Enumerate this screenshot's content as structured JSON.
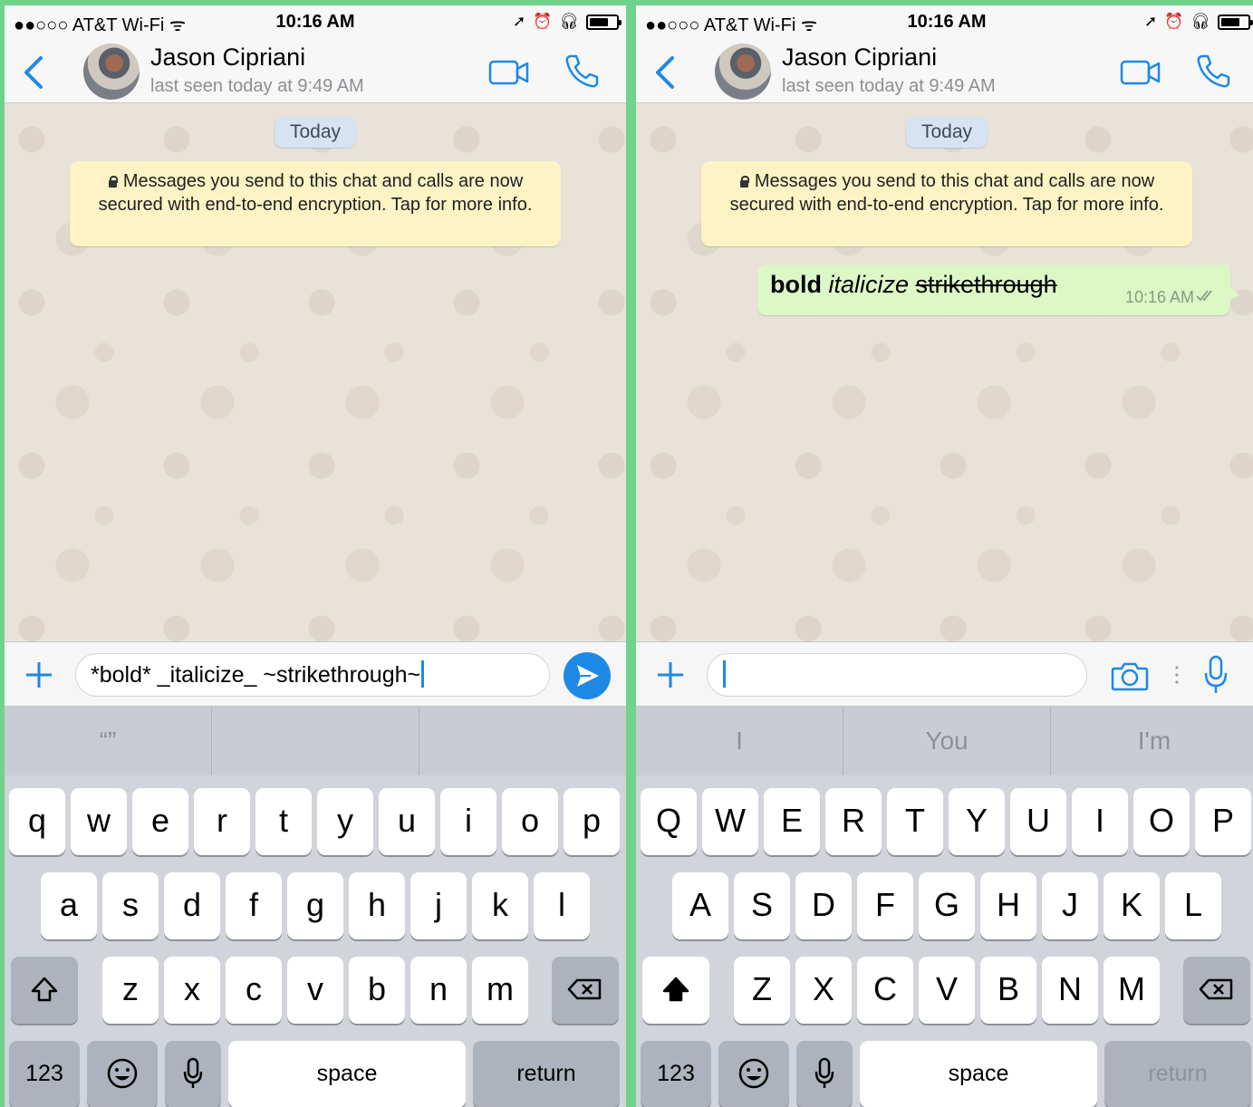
{
  "screens": {
    "left": {
      "status_bar": {
        "carrier": "●●○○○ AT&T Wi-Fi ᯤ",
        "time": "10:16 AM"
      },
      "header": {
        "contact_name": "Jason Cipriani",
        "last_seen": "last seen today at 9:49 AM"
      },
      "chat": {
        "date_label": "Today",
        "encryption_note": "Messages you send to this chat and calls are now secured with end-to-end encryption. Tap for more info."
      },
      "input": {
        "text": "*bold* _italicize_ ~strikethrough~"
      },
      "predictions": [
        "“”",
        "",
        ""
      ],
      "keyboard": {
        "row1": [
          "q",
          "w",
          "e",
          "r",
          "t",
          "y",
          "u",
          "i",
          "o",
          "p"
        ],
        "row2": [
          "a",
          "s",
          "d",
          "f",
          "g",
          "h",
          "j",
          "k",
          "l"
        ],
        "row3": [
          "z",
          "x",
          "c",
          "v",
          "b",
          "n",
          "m"
        ],
        "numbers_label": "123",
        "space_label": "space",
        "return_label": "return"
      }
    },
    "right": {
      "status_bar": {
        "carrier": "●●○○○ AT&T Wi-Fi ᯤ",
        "time": "10:16 AM"
      },
      "header": {
        "contact_name": "Jason Cipriani",
        "last_seen": "last seen today at 9:49 AM"
      },
      "chat": {
        "date_label": "Today",
        "encryption_note": "Messages you send to this chat and calls are now secured with end-to-end encryption. Tap for more info.",
        "message": {
          "bold": "bold",
          "italic": "italicize",
          "strike": "strikethrough",
          "time": "10:16 AM"
        }
      },
      "input": {
        "text": ""
      },
      "predictions": [
        "I",
        "You",
        "I'm"
      ],
      "keyboard": {
        "row1": [
          "Q",
          "W",
          "E",
          "R",
          "T",
          "Y",
          "U",
          "I",
          "O",
          "P"
        ],
        "row2": [
          "A",
          "S",
          "D",
          "F",
          "G",
          "H",
          "J",
          "K",
          "L"
        ],
        "row3": [
          "Z",
          "X",
          "C",
          "V",
          "B",
          "N",
          "M"
        ],
        "numbers_label": "123",
        "space_label": "space",
        "return_label": "return"
      }
    }
  },
  "colors": {
    "accent": "#1e88e5",
    "frame_background": "#6fd38a",
    "bubble_outgoing": "#dcf8c6",
    "encryption_note": "#fdf3c4",
    "date_chip": "#d5e3f3"
  },
  "icons": [
    "back-chevron-icon",
    "video-call-icon",
    "phone-icon",
    "lock-icon",
    "plus-icon",
    "send-icon",
    "camera-icon",
    "microphone-icon",
    "shift-icon",
    "delete-icon",
    "emoji-icon",
    "double-check-icon",
    "location-arrow-icon",
    "alarm-icon",
    "headphones-icon",
    "battery-icon"
  ]
}
